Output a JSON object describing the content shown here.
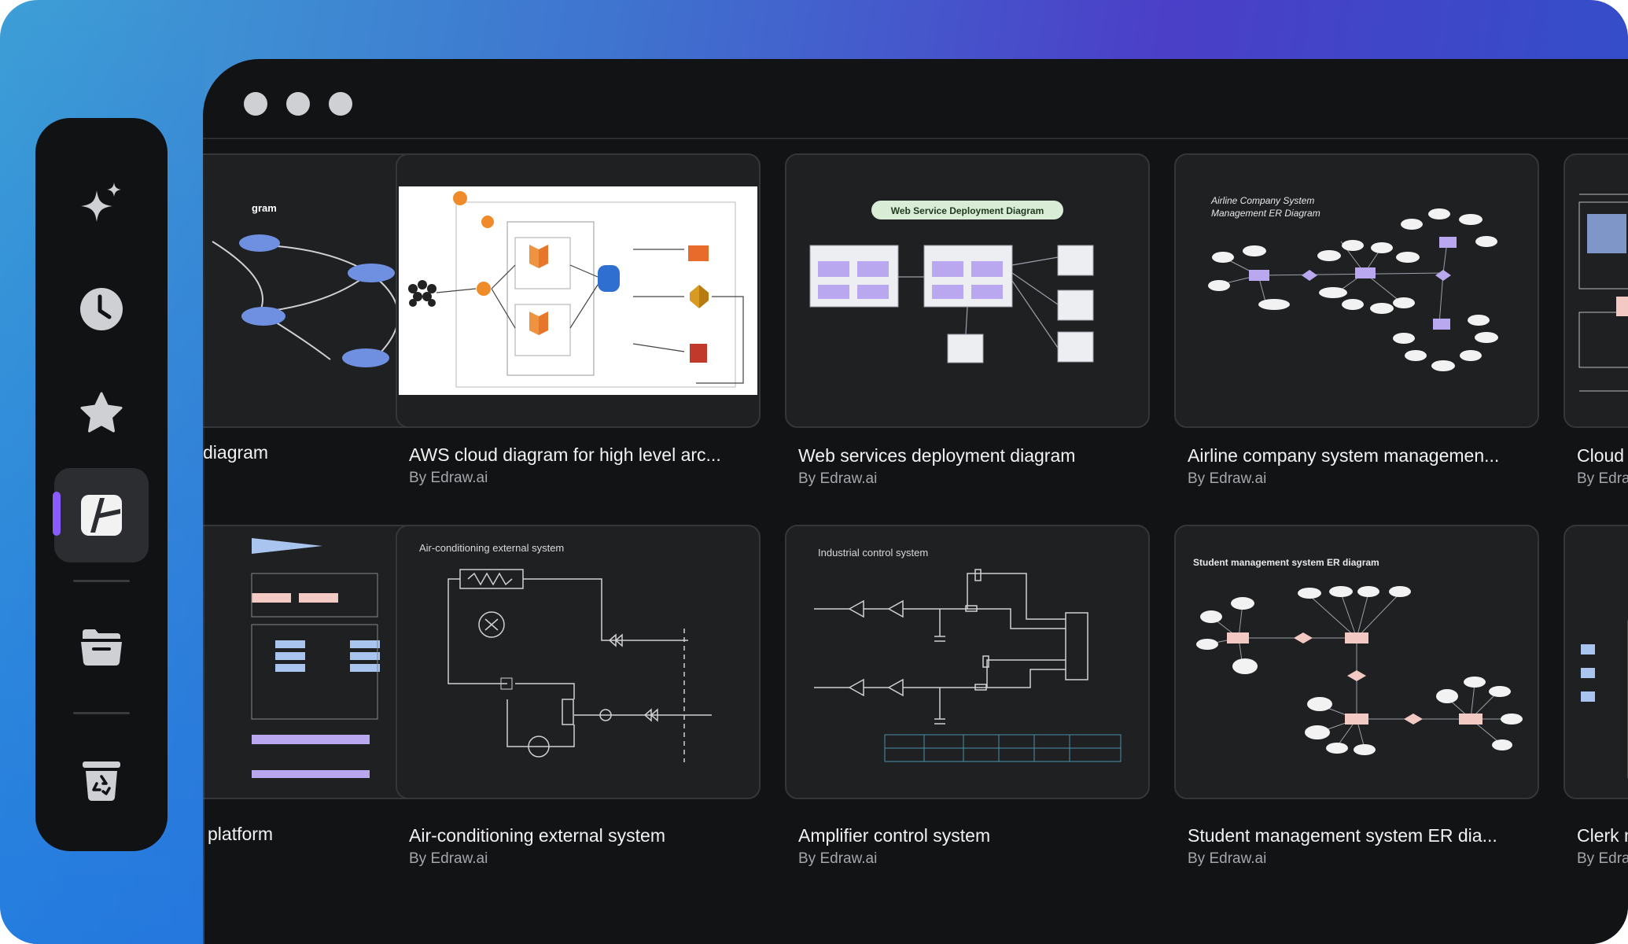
{
  "window": {
    "controls": [
      "close",
      "minimize",
      "maximize"
    ]
  },
  "sidebar": {
    "items": [
      {
        "name": "ai-sparkle-icon",
        "active": false
      },
      {
        "name": "clock-icon",
        "active": false
      },
      {
        "name": "star-icon",
        "active": false
      },
      {
        "name": "templates-icon",
        "active": true
      },
      {
        "name": "folder-icon",
        "active": false
      },
      {
        "name": "recycle-bin-icon",
        "active": false
      }
    ],
    "accent": "#8a5cff"
  },
  "templates": {
    "row1": [
      {
        "title": "diagram",
        "author": "",
        "thumb_style": "dark"
      },
      {
        "title": "AWS cloud diagram for high level arc...",
        "author": "By Edraw.ai",
        "thumb_style": "light"
      },
      {
        "title": "Web services deployment diagram",
        "author": "By Edraw.ai",
        "thumb_style": "dark",
        "thumb_heading": "Web Service Deployment Diagram"
      },
      {
        "title": "Airline company system managemen...",
        "author": "By Edraw.ai",
        "thumb_style": "dark",
        "thumb_heading": "Airline Company System Management ER Diagram"
      },
      {
        "title": "Cloud s",
        "author": "By Edra",
        "thumb_style": "dark"
      }
    ],
    "row2": [
      {
        "title": "platform",
        "author": "",
        "thumb_style": "dark"
      },
      {
        "title": "Air-conditioning external system",
        "author": "By Edraw.ai",
        "thumb_style": "dark",
        "thumb_heading": "Air-conditioning external system"
      },
      {
        "title": "Amplifier control system",
        "author": "By Edraw.ai",
        "thumb_style": "dark",
        "thumb_heading": "Industrial control system"
      },
      {
        "title": "Student management system ER dia...",
        "author": "By Edraw.ai",
        "thumb_style": "dark",
        "thumb_heading": "Student management system ER diagram"
      },
      {
        "title": "Clerk m",
        "author": "By Edra",
        "thumb_style": "dark"
      }
    ]
  },
  "colors": {
    "window_bg": "#121314",
    "card_bg": "#1f2022",
    "card_border": "#34363a",
    "er_pink": "#f3c9c3",
    "er_purple": "#b9a8f0"
  }
}
